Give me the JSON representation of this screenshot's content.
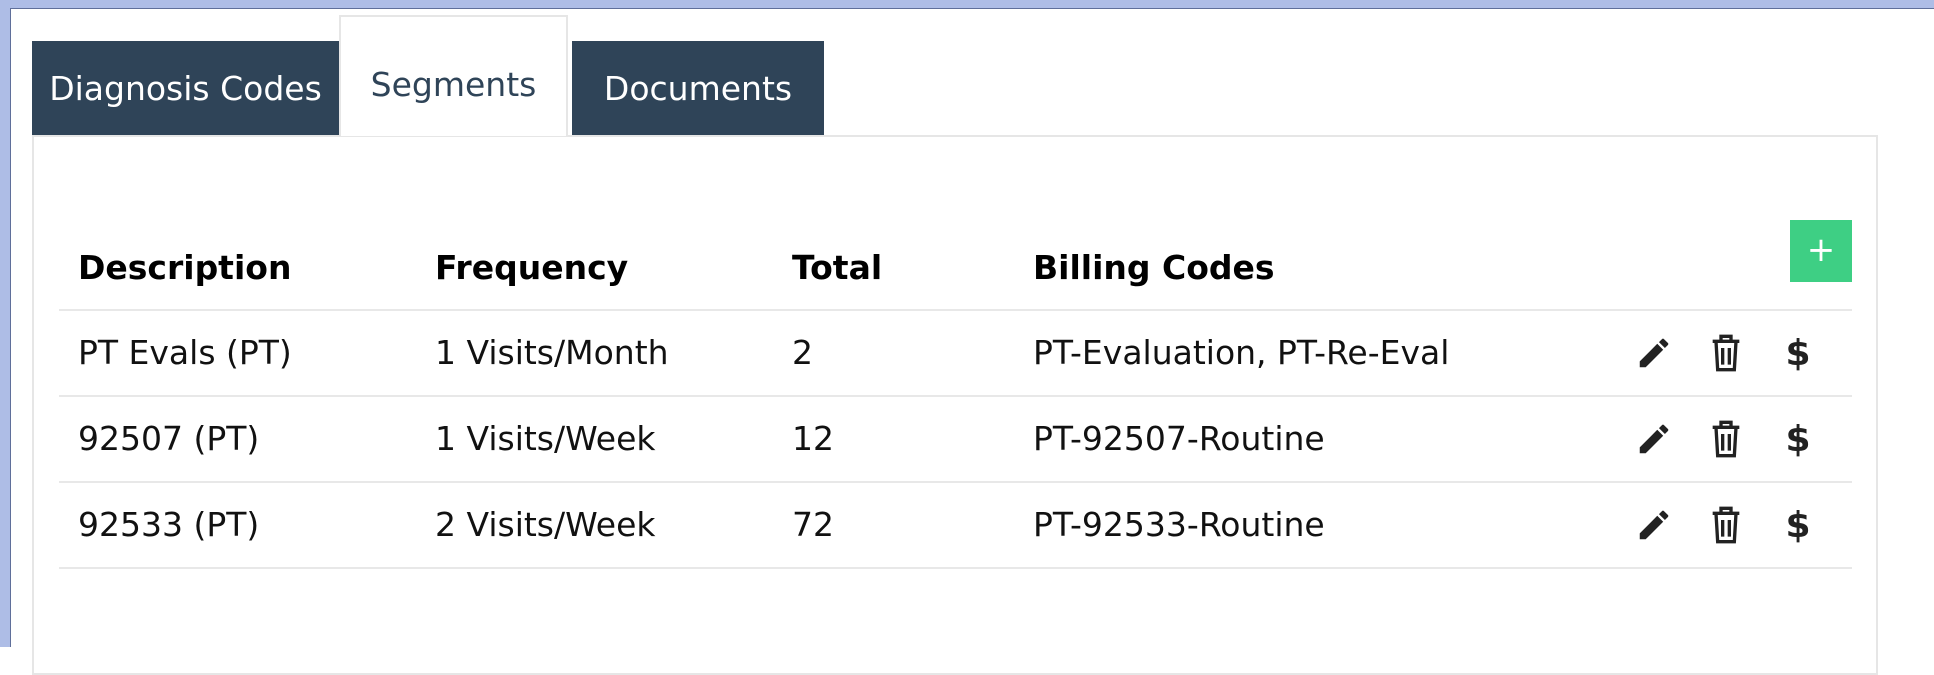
{
  "tabs": [
    {
      "label": "Diagnosis Codes",
      "active": false
    },
    {
      "label": "Segments",
      "active": true
    },
    {
      "label": "Documents",
      "active": false
    }
  ],
  "table": {
    "headers": {
      "description": "Description",
      "frequency": "Frequency",
      "total": "Total",
      "billing_codes": "Billing Codes"
    },
    "add_label": "+",
    "rows": [
      {
        "description": "PT Evals (PT)",
        "frequency": "1 Visits/Month",
        "total": "2",
        "billing_codes": "PT-Evaluation, PT-Re-Eval"
      },
      {
        "description": "92507 (PT)",
        "frequency": "1 Visits/Week",
        "total": "12",
        "billing_codes": "PT-92507-Routine"
      },
      {
        "description": "92533 (PT)",
        "frequency": "2 Visits/Week",
        "total": "72",
        "billing_codes": "PT-92533-Routine"
      }
    ],
    "billing_symbol": "$"
  },
  "icons": {
    "edit": "pencil-icon",
    "delete": "trash-icon",
    "billing": "dollar-icon"
  },
  "colors": {
    "tab_dark": "#2f4458",
    "add_button": "#3ecf84",
    "frame": "#aebde6"
  }
}
